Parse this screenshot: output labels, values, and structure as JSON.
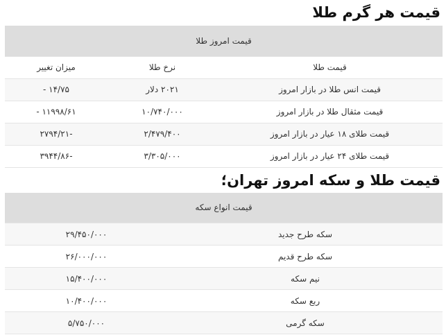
{
  "section1": {
    "title": "قیمت هر گرم طلا",
    "table_caption": "قیمت امروز طلا",
    "columns": [
      "قیمت طلا",
      "نرخ طلا",
      "میزان تغییر"
    ],
    "rows": [
      [
        "قیمت انس طلا در بازار امروز",
        "۲۰۲۱ دلار",
        "۱۴/۷۵ -"
      ],
      [
        "قیمت مثقال طلا در بازار امروز",
        "۱۰/۷۴۰/۰۰۰",
        "۱۱۹۹۸/۶۱ -"
      ],
      [
        "قیمت طلای ۱۸ عیار در بازار امروز",
        "۲/۴۷۹/۴۰۰",
        "-۲۷۹۴/۲۱"
      ],
      [
        "قیمت طلای ۲۴ عیار در بازار امروز",
        "۳/۳۰۵/۰۰۰",
        "-۳۹۴۴/۸۶"
      ]
    ]
  },
  "section2": {
    "title": "قیمت طلا و سکه امروز تهران؛",
    "table_caption": "قیمت انواع سکه",
    "rows": [
      [
        "سکه طرح جدید",
        "۲۹/۴۵۰/۰۰۰"
      ],
      [
        "سکه طرح قدیم",
        "۲۶/۰۰۰/۰۰۰"
      ],
      [
        "نیم سکه",
        "۱۵/۴۰۰/۰۰۰"
      ],
      [
        "ربع سکه",
        "۱۰/۴۰۰/۰۰۰"
      ],
      [
        "سکه گرمی",
        "۵/۷۵۰/۰۰۰"
      ]
    ]
  }
}
